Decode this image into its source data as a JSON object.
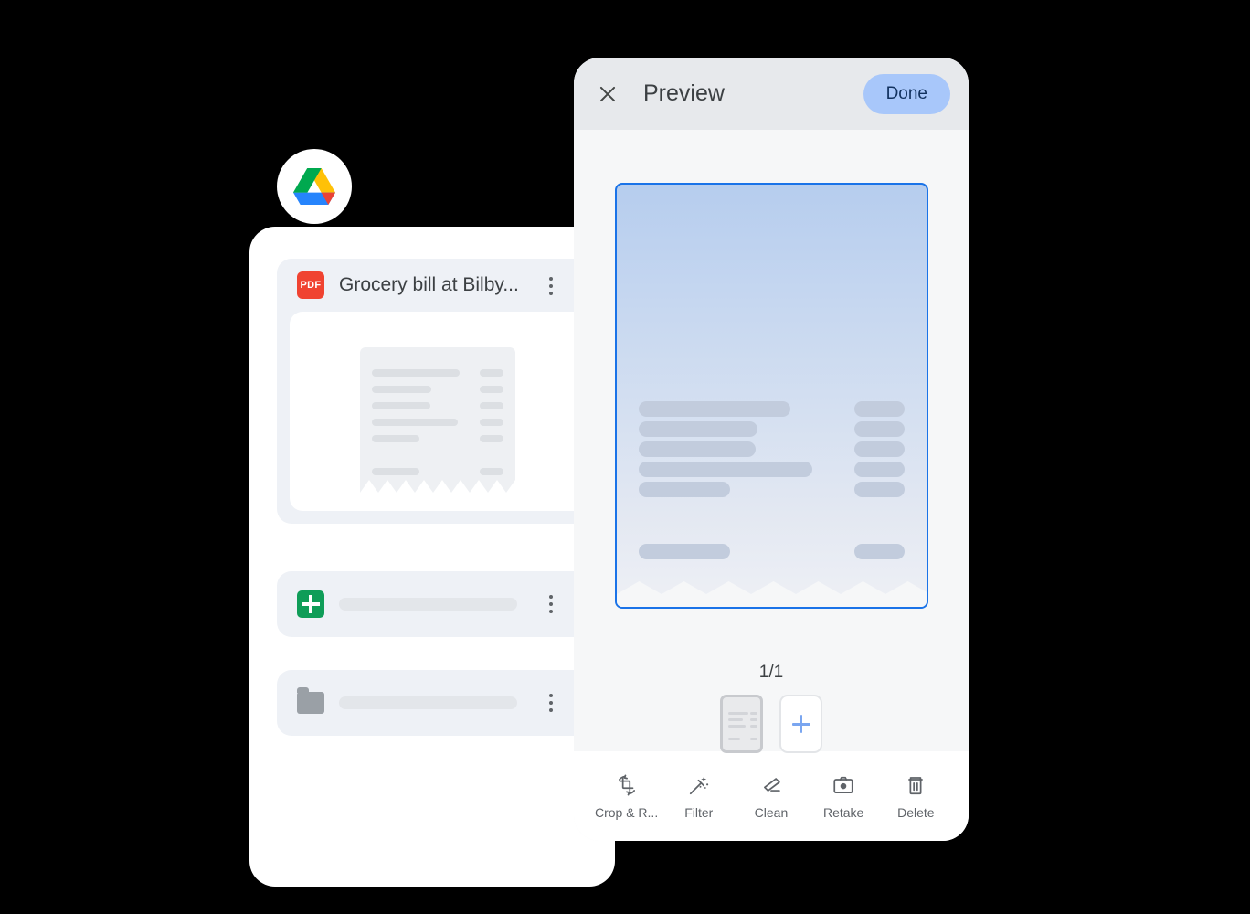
{
  "app": {
    "brand_icon": "google-drive-logo",
    "accent_blue": "#1a73e8",
    "done_button_bg": "#a8c7fa",
    "pdf_icon_bg": "#f04331",
    "sheets_icon_bg": "#0f9d58",
    "folder_icon_color": "#9aa0a6"
  },
  "files_card": {
    "items": [
      {
        "icon": "pdf-icon",
        "icon_label": "PDF",
        "name": "Grocery bill at Bilby...",
        "menu_icon": "kebab-menu-icon",
        "thumbnail": "receipt-thumbnail",
        "status_icon": "loading-spinner"
      },
      {
        "icon": "google-sheets-icon",
        "name": "",
        "menu_icon": "kebab-menu-icon"
      },
      {
        "icon": "folder-icon",
        "name": "",
        "menu_icon": "kebab-menu-icon"
      }
    ]
  },
  "preview": {
    "close_icon": "close-icon",
    "title": "Preview",
    "done_label": "Done",
    "document_preview_icon": "receipt-document",
    "page_indicator": "1/1",
    "add_page_icon": "plus-icon",
    "page_thumb_icon": "receipt-page-thumbnail",
    "toolbar": [
      {
        "icon": "crop-rotate-icon",
        "label": "Crop & R..."
      },
      {
        "icon": "magic-wand-filter-icon",
        "label": "Filter"
      },
      {
        "icon": "eraser-clean-icon",
        "label": "Clean"
      },
      {
        "icon": "camera-retake-icon",
        "label": "Retake"
      },
      {
        "icon": "trash-delete-icon",
        "label": "Delete"
      }
    ]
  }
}
